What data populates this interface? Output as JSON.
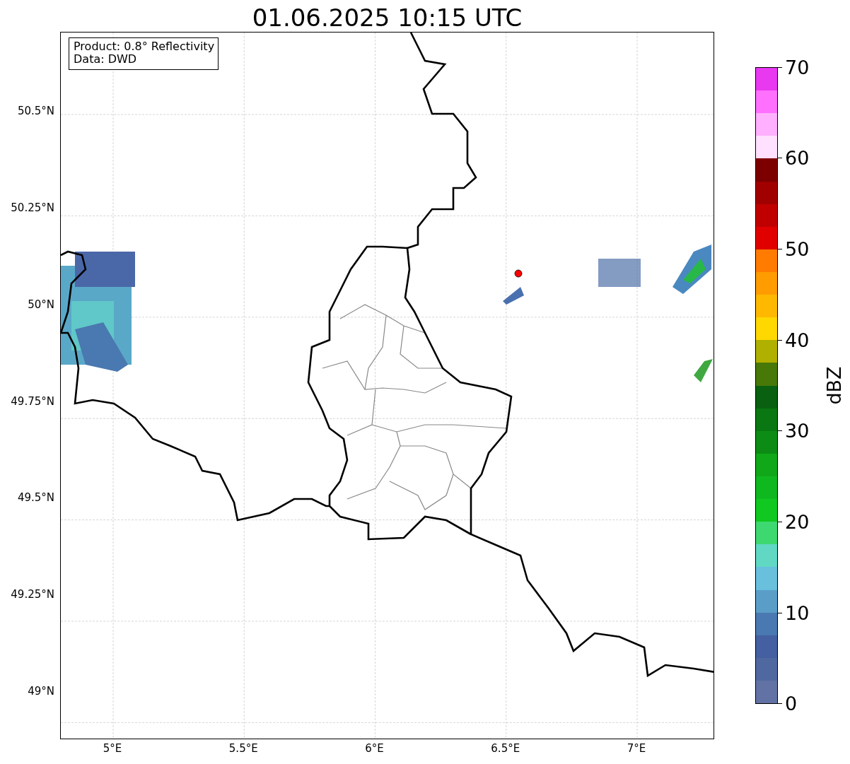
{
  "title": "01.06.2025 10:15 UTC",
  "map": {
    "info_box": [
      "Product: 0.8° Reflectivity",
      "Data: DWD"
    ],
    "lat_ticks": [
      "50.5°N",
      "50.25°N",
      "50°N",
      "49.75°N",
      "49.5°N",
      "49.25°N",
      "49°N"
    ],
    "lon_ticks": [
      "5°E",
      "5.5°E",
      "6°E",
      "6.5°E",
      "7°E"
    ]
  },
  "colorbar": {
    "label": "dBZ",
    "ticks": [
      "70",
      "60",
      "50",
      "40",
      "30",
      "20",
      "10",
      "0"
    ],
    "bands": [
      {
        "color": "#e838f0"
      },
      {
        "color": "#ff70ff"
      },
      {
        "color": "#ffb0ff"
      },
      {
        "color": "#ffe0ff"
      },
      {
        "color": "#7c0000"
      },
      {
        "color": "#a00000"
      },
      {
        "color": "#c00000"
      },
      {
        "color": "#e00000"
      },
      {
        "color": "#ff7c00"
      },
      {
        "color": "#ff9c00"
      },
      {
        "color": "#ffb800"
      },
      {
        "color": "#ffd800"
      },
      {
        "color": "#b0b000"
      },
      {
        "color": "#487808"
      },
      {
        "color": "#086010"
      },
      {
        "color": "#0a7812"
      },
      {
        "color": "#0c8c14"
      },
      {
        "color": "#10a818"
      },
      {
        "color": "#10b820"
      },
      {
        "color": "#10c820"
      },
      {
        "color": "#3ed870"
      },
      {
        "color": "#60d8c4"
      },
      {
        "color": "#68c0dc"
      },
      {
        "color": "#5a9ec8"
      },
      {
        "color": "#4a78b0"
      },
      {
        "color": "#4460a0"
      },
      {
        "color": "#5068a0"
      },
      {
        "color": "#6272a4"
      }
    ]
  }
}
